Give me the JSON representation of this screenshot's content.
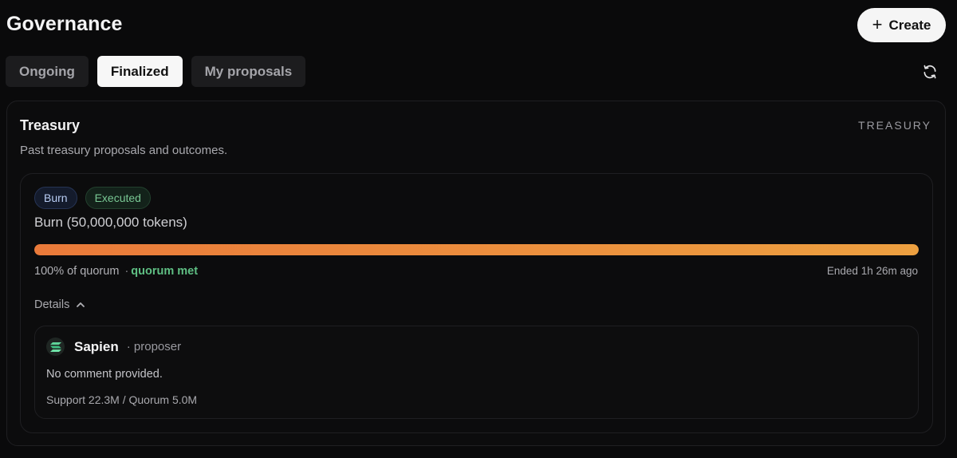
{
  "header": {
    "title": "Governance",
    "create_icon": "plus-icon",
    "create_label": "Create"
  },
  "tabs": [
    {
      "label": "Ongoing",
      "active": false
    },
    {
      "label": "Finalized",
      "active": true
    },
    {
      "label": "My proposals",
      "active": false
    }
  ],
  "refresh_icon": "refresh-icon",
  "section": {
    "title": "Treasury",
    "category": "TREASURY",
    "description": "Past treasury proposals and outcomes."
  },
  "proposal": {
    "type_badge": "Burn",
    "status_badge": "Executed",
    "title": "Burn (50,000,000 tokens)",
    "progress_fraction": 1.0,
    "quorum_text": "100% of quorum",
    "separator": "·",
    "quorum_status": "quorum met",
    "ended": "Ended 1h 26m ago",
    "details_label": "Details",
    "details_icon": "chevron-up-icon",
    "comment": {
      "author": "Sapien",
      "role": "· proposer",
      "avatar_icon": "sapien-logo-icon",
      "text": "No comment provided.",
      "support": "Support 22.3M / Quorum 5.0M"
    }
  },
  "colors": {
    "background": "#0a0a0b",
    "progress_start": "#ea7a3a",
    "progress_end": "#eda040",
    "quorum_met": "#5fbf83",
    "executed_badge": "#79c894",
    "burn_badge": "#b9cdf4"
  }
}
